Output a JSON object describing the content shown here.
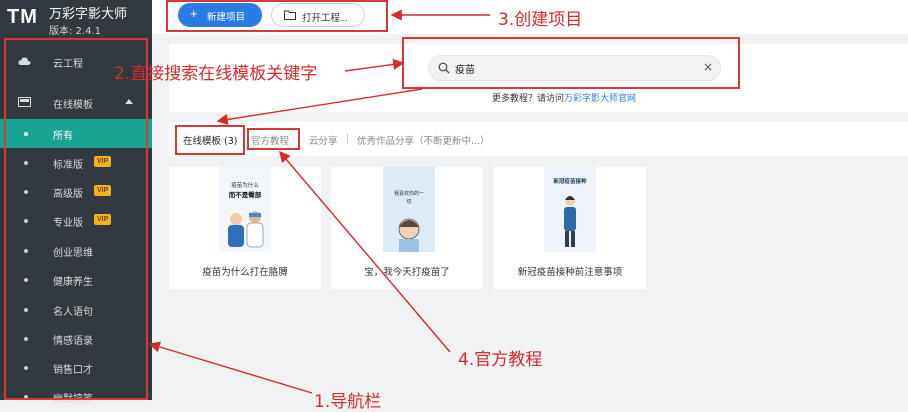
{
  "app": {
    "logo": "TM",
    "name": "万彩字影大师",
    "version": "版本: 2.4.1"
  },
  "sidebar": {
    "cloud": "云工程",
    "template": "在线模板",
    "items": [
      {
        "label": "所有",
        "vip": ""
      },
      {
        "label": "标准版",
        "vip": "VIP"
      },
      {
        "label": "高级版",
        "vip": "VIP"
      },
      {
        "label": "专业版",
        "vip": "VIP"
      },
      {
        "label": "创业思维",
        "vip": ""
      },
      {
        "label": "健康养生",
        "vip": ""
      },
      {
        "label": "名人语句",
        "vip": ""
      },
      {
        "label": "情感语录",
        "vip": ""
      },
      {
        "label": "销售口才",
        "vip": ""
      },
      {
        "label": "幽默搞笑",
        "vip": ""
      }
    ]
  },
  "toolbar": {
    "new_label": "新建项目",
    "open_label": "打开工程..."
  },
  "search": {
    "value": "疫苗",
    "clear": "×"
  },
  "more": {
    "prefix": "更多教程？请访问",
    "link": "万彩字影大师官网"
  },
  "tabs": {
    "online": "在线模板 (3)",
    "official": "官方教程",
    "cloud": "云分享",
    "sep": "|",
    "excellent": "优秀作品分享（不断更新中...）"
  },
  "cards": [
    {
      "caption": "疫苗为什么打在胳膊",
      "thumb_line1": "疫苗为什么",
      "thumb_line2": "而不是臀部"
    },
    {
      "caption": "宝，我今天打疫苗了",
      "thumb_line1": "我喜欢你的一",
      "thumb_line2": "切"
    },
    {
      "caption": "新冠疫苗接种前注意事项",
      "thumb_line1": "新冠疫苗接种",
      "thumb_line2": ""
    }
  ],
  "annotations": {
    "a1": "1.导航栏",
    "a2": "2.直接搜索在线模板关键字",
    "a3": "3.创建项目",
    "a4": "4.官方教程"
  },
  "colors": {
    "sidebar": "#32393f",
    "active": "#17a493",
    "accent": "#2c7be5",
    "annotation": "#d42b2b",
    "vip": "#f2b21e"
  }
}
